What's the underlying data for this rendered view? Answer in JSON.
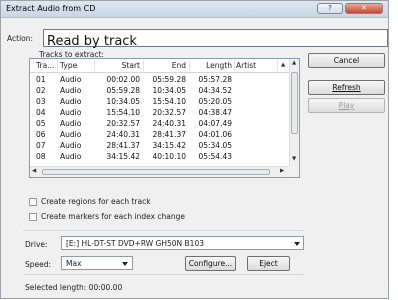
{
  "window": {
    "title": "Extract Audio from CD",
    "help_glyph": "?",
    "close_glyph": "✕"
  },
  "action": {
    "label": "Action:",
    "value": "Read by track"
  },
  "tracks": {
    "label": "Tracks to extract:",
    "columns": [
      "Tra...",
      "Type",
      "Start",
      "End",
      "Length",
      "Artist"
    ],
    "rows": [
      [
        "01",
        "Audio",
        "00:02.00",
        "05:59.28",
        "05:57.28"
      ],
      [
        "02",
        "Audio",
        "05:59.28",
        "10:34.05",
        "04:34.52"
      ],
      [
        "03",
        "Audio",
        "10:34.05",
        "15:54.10",
        "05:20.05"
      ],
      [
        "04",
        "Audio",
        "15:54.10",
        "20:32.57",
        "04:38.47"
      ],
      [
        "05",
        "Audio",
        "20:32.57",
        "24:40.31",
        "04:07.49"
      ],
      [
        "06",
        "Audio",
        "24:40.31",
        "28:41.37",
        "04:01.06"
      ],
      [
        "07",
        "Audio",
        "28:41.37",
        "34:15.42",
        "05:34.05"
      ],
      [
        "08",
        "Audio",
        "34:15.42",
        "40:10.10",
        "05:54.43"
      ]
    ]
  },
  "buttons": {
    "cancel": "Cancel",
    "refresh": "Refresh",
    "play": "Play",
    "configure": "Configure...",
    "eject": "Eject"
  },
  "options": {
    "create_regions": "Create regions for each track",
    "create_markers": "Create markers for each index change"
  },
  "drive": {
    "label": "Drive:",
    "value": "[E:] HL-DT-ST DVD+RW GH50N B103"
  },
  "speed": {
    "label": "Speed:",
    "value": "Max"
  },
  "status": {
    "selected_length": "Selected length:  00:00.00"
  }
}
